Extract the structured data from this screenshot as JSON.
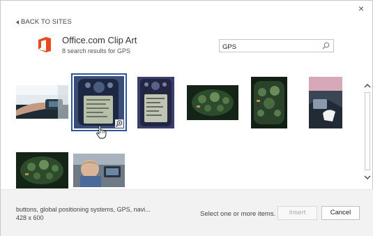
{
  "dialog": {
    "close_glyph": "×",
    "back_label": "BACK TO SITES"
  },
  "provider": {
    "title": "Office.com Clip Art",
    "results_text": "8 search results for GPS",
    "logo_icon": "office-logo-icon",
    "logo_color": "#e84a1b"
  },
  "search": {
    "value": "GPS",
    "icon": "search-icon"
  },
  "results": {
    "items": [
      {
        "name": "result-gps-hand-dashboard",
        "selected": false
      },
      {
        "name": "result-gps-handheld-closeup",
        "selected": true
      },
      {
        "name": "result-gps-handheld-purple",
        "selected": false
      },
      {
        "name": "result-gps-buttons-green",
        "selected": false
      },
      {
        "name": "result-gps-buttons-dark",
        "selected": false
      },
      {
        "name": "result-gps-car-hand",
        "selected": false
      },
      {
        "name": "result-gps-buttons-green-2",
        "selected": false
      },
      {
        "name": "result-gps-child-car",
        "selected": false
      }
    ],
    "selected_index": 1,
    "zoom_icon": "magnify-plus-icon"
  },
  "scroll": {
    "up_glyph": "⌃",
    "down_glyph": "⌄"
  },
  "footer": {
    "caption": "buttons, global positioning systems, GPS, navi...",
    "dimensions": "428 x 600",
    "hint": "Select one or more items.",
    "insert_label": "Insert",
    "cancel_label": "Cancel"
  },
  "colors": {
    "selection_outline": "#2b5797",
    "footer_bg": "#f2f2f2"
  }
}
